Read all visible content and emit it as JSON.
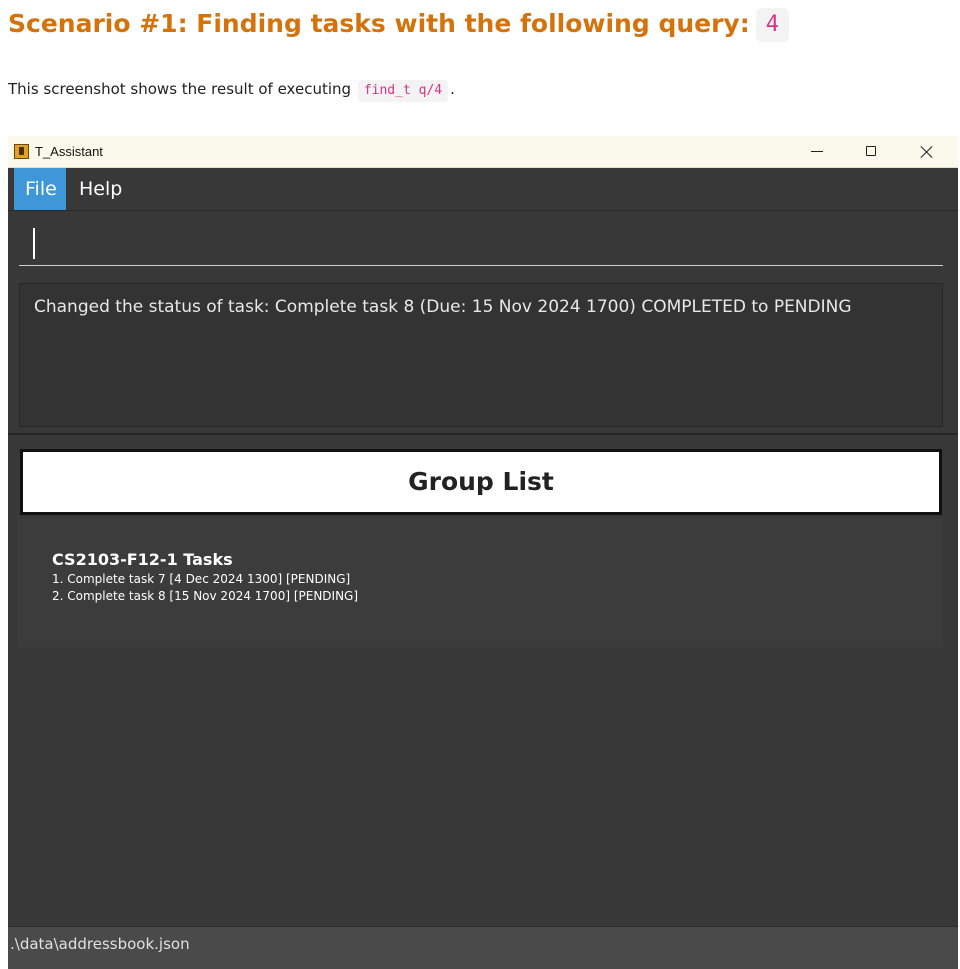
{
  "doc": {
    "heading_text": "Scenario #1: Finding tasks with the following query:",
    "heading_code": "4",
    "para_before": "This screenshot shows the result of executing",
    "para_code": "find_t q/4",
    "para_after": "."
  },
  "window": {
    "title": "T_Assistant",
    "minimize_icon": "minimize-icon",
    "maximize_icon": "maximize-icon",
    "close_icon": "close-icon"
  },
  "menu": {
    "items": [
      {
        "label": "File",
        "active": true
      },
      {
        "label": "Help",
        "active": false
      }
    ]
  },
  "command_box": {
    "value": ""
  },
  "result_display": {
    "text": "Changed the status of task: Complete task 8 (Due: 15 Nov 2024 1700) COMPLETED to PENDING"
  },
  "group_list": {
    "title": "Group List",
    "groups": [
      {
        "name": "CS2103-F12-1 Tasks",
        "tasks": [
          "1. Complete task 7 [4 Dec 2024 1300] [PENDING]",
          "2. Complete task 8 [15 Nov 2024 1700] [PENDING]"
        ]
      }
    ]
  },
  "status_bar": {
    "path": ".\\data\\addressbook.json"
  },
  "colors": {
    "heading": "#d4730b",
    "code_text": "#d63384",
    "menu_active": "#3e97d8",
    "app_bg": "#383838"
  }
}
